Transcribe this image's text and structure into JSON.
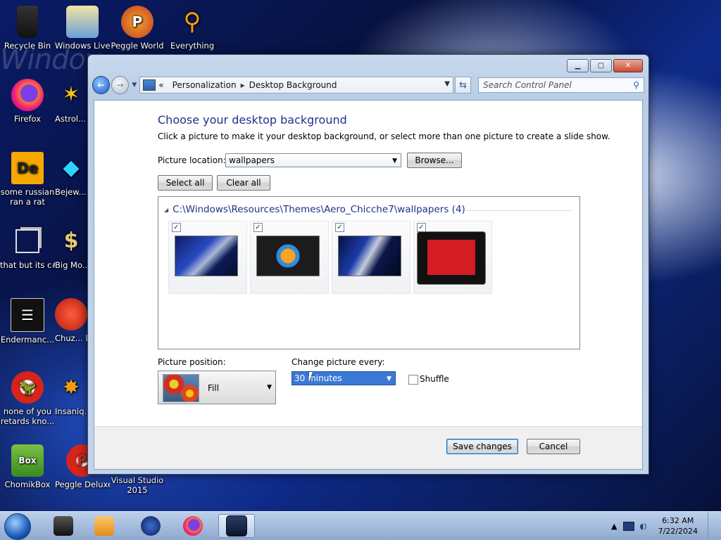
{
  "desktop": {
    "icons": [
      {
        "label": "Recycle Bin"
      },
      {
        "label": "Windows Live Ma..."
      },
      {
        "label": "Peggle World"
      },
      {
        "label": "Everything"
      },
      {
        "label": "Firefox"
      },
      {
        "label": "Astrol... Delu..."
      },
      {
        "label": "some russian ran a rat"
      },
      {
        "label": "Bejew... Delu..."
      },
      {
        "label": "that but its c#"
      },
      {
        "label": "Big Mo... Delu..."
      },
      {
        "label": "Endermanc..."
      },
      {
        "label": "Chuz... Delu..."
      },
      {
        "label": "none of you retards kno..."
      },
      {
        "label": "Insaniq... Delu..."
      },
      {
        "label": "ChomikBox"
      },
      {
        "label": "Peggle Deluxe"
      },
      {
        "label": "Visual Studio 2015"
      }
    ]
  },
  "window": {
    "breadcrumb": [
      "Personalization",
      "Desktop Background"
    ],
    "search_placeholder": "Search Control Panel",
    "heading": "Choose your desktop background",
    "subtitle": "Click a picture to make it your desktop background, or select more than one picture to create a slide show.",
    "picture_location_label": "Picture location:",
    "picture_location_value": "wallpapers",
    "browse_label": "Browse...",
    "select_all_label": "Select all",
    "clear_all_label": "Clear all",
    "gallery_header": "C:\\Windows\\Resources\\Themes\\Aero_Chicche7\\wallpapers (4)",
    "thumbnails_checked": [
      true,
      true,
      true,
      true
    ],
    "picture_position_label": "Picture position:",
    "picture_position_value": "Fill",
    "change_picture_label": "Change picture every:",
    "change_picture_value": "30 minutes",
    "shuffle_label": "Shuffle",
    "save_label": "Save changes",
    "cancel_label": "Cancel"
  },
  "taskbar": {
    "time": "6:32 AM",
    "date": "7/22/2024"
  },
  "colors": {
    "heading": "#1e3287",
    "accent": "#3a79d6"
  }
}
